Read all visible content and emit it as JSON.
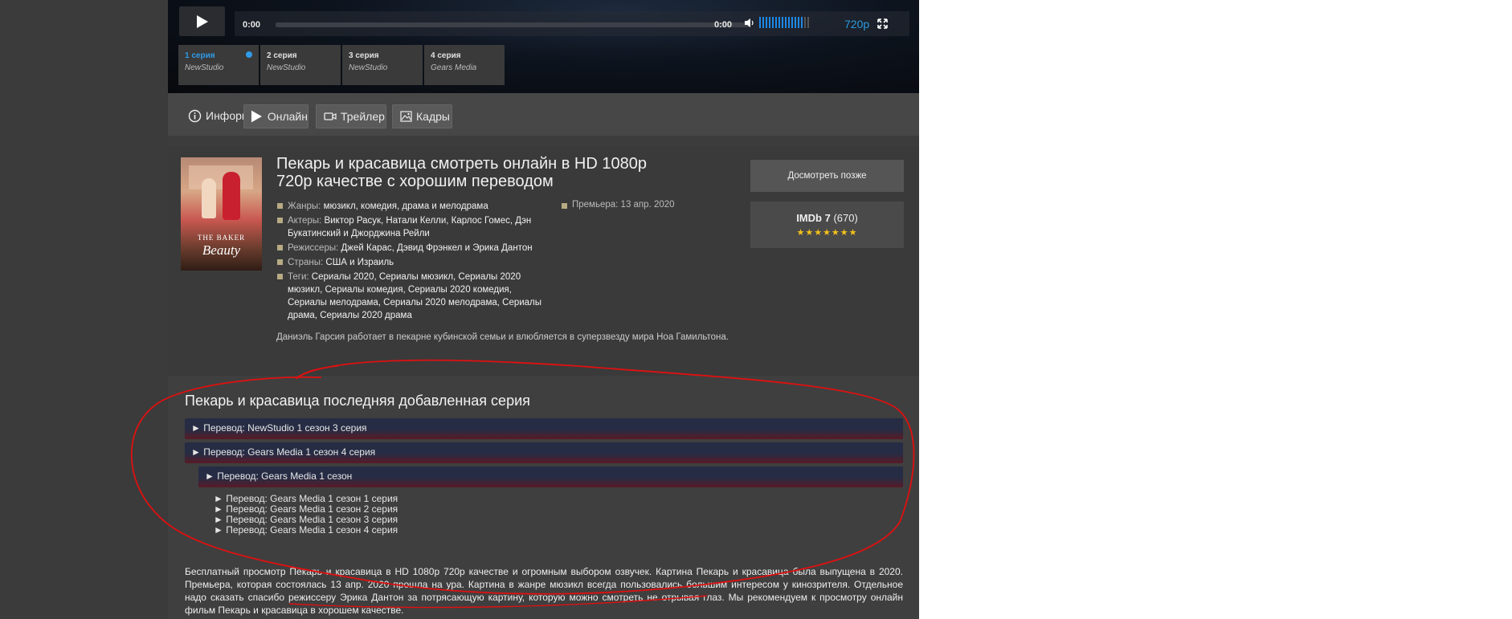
{
  "player": {
    "time_current": "0:00",
    "time_total": "0:00",
    "quality": "720p",
    "volume_level": 0.85,
    "episodes": [
      {
        "label": "1 серия",
        "studio": "NewStudio",
        "active": true
      },
      {
        "label": "2 серия",
        "studio": "NewStudio",
        "active": false
      },
      {
        "label": "3 серия",
        "studio": "NewStudio",
        "active": false
      },
      {
        "label": "4 серия",
        "studio": "Gears Media",
        "active": false
      }
    ]
  },
  "tabs": {
    "info": "Информация",
    "online": "Онлайн",
    "trailer": "Трейлер",
    "frames": "Кадры"
  },
  "movie": {
    "poster_title_top": "THE BAKER",
    "poster_title_bottom": "Beauty",
    "title": "Пекарь и красавица смотреть онлайн в HD 1080p 720p качестве с хорошим переводом",
    "genres_label": "Жанры:",
    "genres": "мюзикл, комедия, драма и мелодрама",
    "actors_label": "Актеры:",
    "actors": "Виктор Расук, Натали Келли, Карлос Гомес, Дэн Букатинский и Джорджина Рейли",
    "directors_label": "Режиссеры:",
    "directors": "Джей Карас, Дэвид Фрэнкел и Эрика Дантон",
    "countries_label": "Страны:",
    "countries": "США и Израиль",
    "tags_label": "Теги:",
    "tags": "Сериалы 2020, Сериалы мюзикл, Сериалы 2020 мюзикл, Сериалы комедия, Сериалы 2020 комедия, Сериалы мелодрама, Сериалы 2020 мелодрама, Сериалы драма, Сериалы 2020 драма",
    "premiere_label": "Премьера:",
    "premiere": "13 апр. 2020",
    "description": "Даниэль Гарсия работает в пекарне кубинской семьи и влюбляется в суперзвезду мира Ноа Гамильтона.",
    "watch_later": "Досмотреть позже",
    "imdb_label": "IMDb 7",
    "imdb_votes": "(670)",
    "stars": "★★★★★★★"
  },
  "latest": {
    "heading": "Пекарь и красавица последняя добавленная серия",
    "bars": [
      "► Перевод: NewStudio 1 сезон 3 серия",
      "► Перевод: Gears Media 1 сезон 4 серия",
      "► Перевод: Gears Media 1 сезон"
    ],
    "episodes": [
      "► Перевод: Gears Media 1 сезон 1 серия",
      "► Перевод: Gears Media 1 сезон 2 серия",
      "► Перевод: Gears Media 1 сезон 3 серия",
      "► Перевод: Gears Media 1 сезон 4 серия"
    ],
    "seo_text": "Бесплатный просмотр Пекарь и красавица в HD 1080p 720p качестве и огромным выбором озвучек. Картина Пекарь и красавица была выпущена в 2020. Премьера, которая состоялась 13 апр. 2020 прошла на ура. Картина в жанре мюзикл всегда пользовались большим интересом у кинозрителя. Отдельное надо сказать спасибо режиссеру Эрика Дантон за потрясающую картину, которую можно смотреть не отрывая глаз. Мы рекомендуем к просмотру онлайн фильм Пекарь и красавица в хорошем качестве."
  },
  "colors": {
    "accent_blue": "#2f9be8",
    "annotation_red": "#e01010",
    "star_yellow": "#f4c21b"
  }
}
